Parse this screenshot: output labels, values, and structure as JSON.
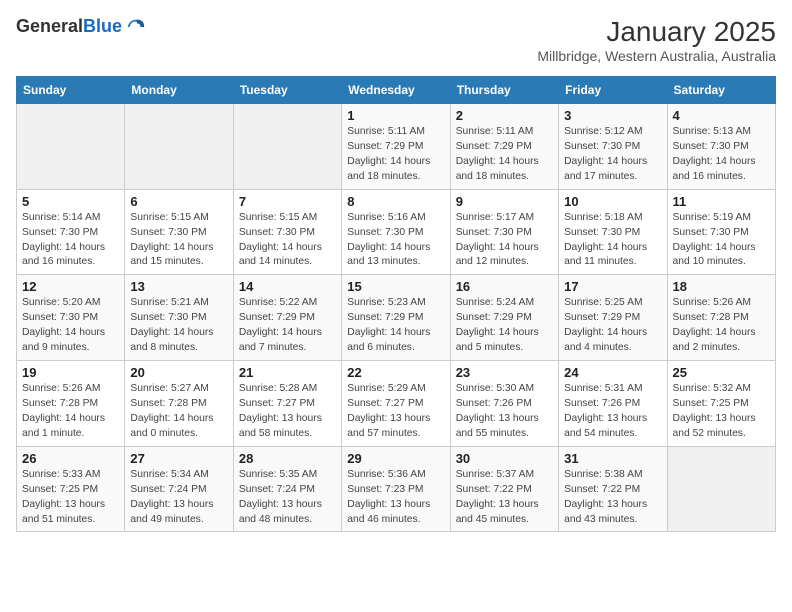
{
  "header": {
    "logo_line1": "General",
    "logo_line2": "Blue",
    "title": "January 2025",
    "subtitle": "Millbridge, Western Australia, Australia"
  },
  "days_of_week": [
    "Sunday",
    "Monday",
    "Tuesday",
    "Wednesday",
    "Thursday",
    "Friday",
    "Saturday"
  ],
  "weeks": [
    [
      {
        "day": "",
        "info": ""
      },
      {
        "day": "",
        "info": ""
      },
      {
        "day": "",
        "info": ""
      },
      {
        "day": "1",
        "info": "Sunrise: 5:11 AM\nSunset: 7:29 PM\nDaylight: 14 hours\nand 18 minutes."
      },
      {
        "day": "2",
        "info": "Sunrise: 5:11 AM\nSunset: 7:29 PM\nDaylight: 14 hours\nand 18 minutes."
      },
      {
        "day": "3",
        "info": "Sunrise: 5:12 AM\nSunset: 7:30 PM\nDaylight: 14 hours\nand 17 minutes."
      },
      {
        "day": "4",
        "info": "Sunrise: 5:13 AM\nSunset: 7:30 PM\nDaylight: 14 hours\nand 16 minutes."
      }
    ],
    [
      {
        "day": "5",
        "info": "Sunrise: 5:14 AM\nSunset: 7:30 PM\nDaylight: 14 hours\nand 16 minutes."
      },
      {
        "day": "6",
        "info": "Sunrise: 5:15 AM\nSunset: 7:30 PM\nDaylight: 14 hours\nand 15 minutes."
      },
      {
        "day": "7",
        "info": "Sunrise: 5:15 AM\nSunset: 7:30 PM\nDaylight: 14 hours\nand 14 minutes."
      },
      {
        "day": "8",
        "info": "Sunrise: 5:16 AM\nSunset: 7:30 PM\nDaylight: 14 hours\nand 13 minutes."
      },
      {
        "day": "9",
        "info": "Sunrise: 5:17 AM\nSunset: 7:30 PM\nDaylight: 14 hours\nand 12 minutes."
      },
      {
        "day": "10",
        "info": "Sunrise: 5:18 AM\nSunset: 7:30 PM\nDaylight: 14 hours\nand 11 minutes."
      },
      {
        "day": "11",
        "info": "Sunrise: 5:19 AM\nSunset: 7:30 PM\nDaylight: 14 hours\nand 10 minutes."
      }
    ],
    [
      {
        "day": "12",
        "info": "Sunrise: 5:20 AM\nSunset: 7:30 PM\nDaylight: 14 hours\nand 9 minutes."
      },
      {
        "day": "13",
        "info": "Sunrise: 5:21 AM\nSunset: 7:30 PM\nDaylight: 14 hours\nand 8 minutes."
      },
      {
        "day": "14",
        "info": "Sunrise: 5:22 AM\nSunset: 7:29 PM\nDaylight: 14 hours\nand 7 minutes."
      },
      {
        "day": "15",
        "info": "Sunrise: 5:23 AM\nSunset: 7:29 PM\nDaylight: 14 hours\nand 6 minutes."
      },
      {
        "day": "16",
        "info": "Sunrise: 5:24 AM\nSunset: 7:29 PM\nDaylight: 14 hours\nand 5 minutes."
      },
      {
        "day": "17",
        "info": "Sunrise: 5:25 AM\nSunset: 7:29 PM\nDaylight: 14 hours\nand 4 minutes."
      },
      {
        "day": "18",
        "info": "Sunrise: 5:26 AM\nSunset: 7:28 PM\nDaylight: 14 hours\nand 2 minutes."
      }
    ],
    [
      {
        "day": "19",
        "info": "Sunrise: 5:26 AM\nSunset: 7:28 PM\nDaylight: 14 hours\nand 1 minute."
      },
      {
        "day": "20",
        "info": "Sunrise: 5:27 AM\nSunset: 7:28 PM\nDaylight: 14 hours\nand 0 minutes."
      },
      {
        "day": "21",
        "info": "Sunrise: 5:28 AM\nSunset: 7:27 PM\nDaylight: 13 hours\nand 58 minutes."
      },
      {
        "day": "22",
        "info": "Sunrise: 5:29 AM\nSunset: 7:27 PM\nDaylight: 13 hours\nand 57 minutes."
      },
      {
        "day": "23",
        "info": "Sunrise: 5:30 AM\nSunset: 7:26 PM\nDaylight: 13 hours\nand 55 minutes."
      },
      {
        "day": "24",
        "info": "Sunrise: 5:31 AM\nSunset: 7:26 PM\nDaylight: 13 hours\nand 54 minutes."
      },
      {
        "day": "25",
        "info": "Sunrise: 5:32 AM\nSunset: 7:25 PM\nDaylight: 13 hours\nand 52 minutes."
      }
    ],
    [
      {
        "day": "26",
        "info": "Sunrise: 5:33 AM\nSunset: 7:25 PM\nDaylight: 13 hours\nand 51 minutes."
      },
      {
        "day": "27",
        "info": "Sunrise: 5:34 AM\nSunset: 7:24 PM\nDaylight: 13 hours\nand 49 minutes."
      },
      {
        "day": "28",
        "info": "Sunrise: 5:35 AM\nSunset: 7:24 PM\nDaylight: 13 hours\nand 48 minutes."
      },
      {
        "day": "29",
        "info": "Sunrise: 5:36 AM\nSunset: 7:23 PM\nDaylight: 13 hours\nand 46 minutes."
      },
      {
        "day": "30",
        "info": "Sunrise: 5:37 AM\nSunset: 7:22 PM\nDaylight: 13 hours\nand 45 minutes."
      },
      {
        "day": "31",
        "info": "Sunrise: 5:38 AM\nSunset: 7:22 PM\nDaylight: 13 hours\nand 43 minutes."
      },
      {
        "day": "",
        "info": ""
      }
    ]
  ]
}
